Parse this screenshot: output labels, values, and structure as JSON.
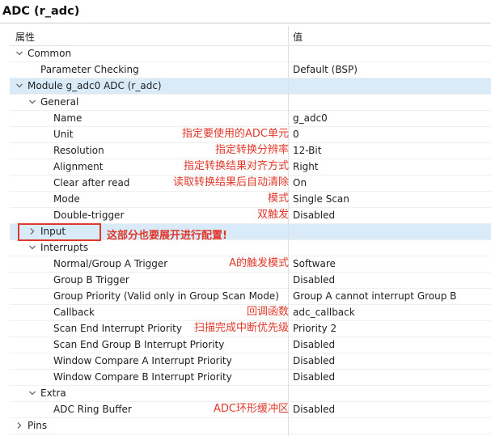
{
  "title": "ADC (r_adc)",
  "columns": {
    "property": "属性",
    "value": "值"
  },
  "rows": [
    {
      "label": "Common",
      "value": "",
      "level": 0,
      "toggle": "expanded"
    },
    {
      "label": "Parameter Checking",
      "value": "Default (BSP)",
      "level": 1,
      "toggle": "none"
    },
    {
      "label": "Module g_adc0 ADC (r_adc)",
      "value": "",
      "level": 0,
      "toggle": "expanded",
      "selected": true
    },
    {
      "label": "General",
      "value": "",
      "level": 1,
      "toggle": "expanded"
    },
    {
      "label": "Name",
      "value": "g_adc0",
      "level": 2,
      "toggle": "none"
    },
    {
      "label": "Unit",
      "value": "0",
      "level": 2,
      "toggle": "none",
      "note": "指定要使用的ADC单元"
    },
    {
      "label": "Resolution",
      "value": "12-Bit",
      "level": 2,
      "toggle": "none",
      "note": "指定转换分辨率"
    },
    {
      "label": "Alignment",
      "value": "Right",
      "level": 2,
      "toggle": "none",
      "note": "指定转换结果对齐方式"
    },
    {
      "label": "Clear after read",
      "value": "On",
      "level": 2,
      "toggle": "none",
      "note": "读取转换结果后自动清除"
    },
    {
      "label": "Mode",
      "value": "Single Scan",
      "level": 2,
      "toggle": "none",
      "note": "模式"
    },
    {
      "label": "Double-trigger",
      "value": "Disabled",
      "level": 2,
      "toggle": "none",
      "note": "双触发"
    },
    {
      "label": "Input",
      "value": "",
      "level": 1,
      "toggle": "collapsed",
      "selected": true
    },
    {
      "label": "Interrupts",
      "value": "",
      "level": 1,
      "toggle": "expanded"
    },
    {
      "label": "Normal/Group A Trigger",
      "value": "Software",
      "level": 2,
      "toggle": "none",
      "note": "A的触发模式"
    },
    {
      "label": "Group B Trigger",
      "value": "Disabled",
      "level": 2,
      "toggle": "none"
    },
    {
      "label": "Group Priority (Valid only in Group Scan Mode)",
      "value": "Group A cannot interrupt Group B",
      "level": 2,
      "toggle": "none"
    },
    {
      "label": "Callback",
      "value": "adc_callback",
      "level": 2,
      "toggle": "none",
      "note": "回调函数"
    },
    {
      "label": "Scan End Interrupt Priority",
      "value": "Priority 2",
      "level": 2,
      "toggle": "none",
      "note": "扫描完成中断优先级"
    },
    {
      "label": "Scan End Group B Interrupt Priority",
      "value": "Disabled",
      "level": 2,
      "toggle": "none"
    },
    {
      "label": "Window Compare A Interrupt Priority",
      "value": "Disabled",
      "level": 2,
      "toggle": "none"
    },
    {
      "label": "Window Compare B Interrupt Priority",
      "value": "Disabled",
      "level": 2,
      "toggle": "none"
    },
    {
      "label": "Extra",
      "value": "",
      "level": 1,
      "toggle": "expanded"
    },
    {
      "label": "ADC Ring Buffer",
      "value": "Disabled",
      "level": 2,
      "toggle": "none",
      "note": "ADC环形缓冲区"
    },
    {
      "label": "Pins",
      "value": "",
      "level": 0,
      "toggle": "collapsed"
    }
  ],
  "callout": "这部分也要展开进行配置!",
  "colors": {
    "annotation": "#e0392b",
    "selection": "#d9ebf9"
  }
}
